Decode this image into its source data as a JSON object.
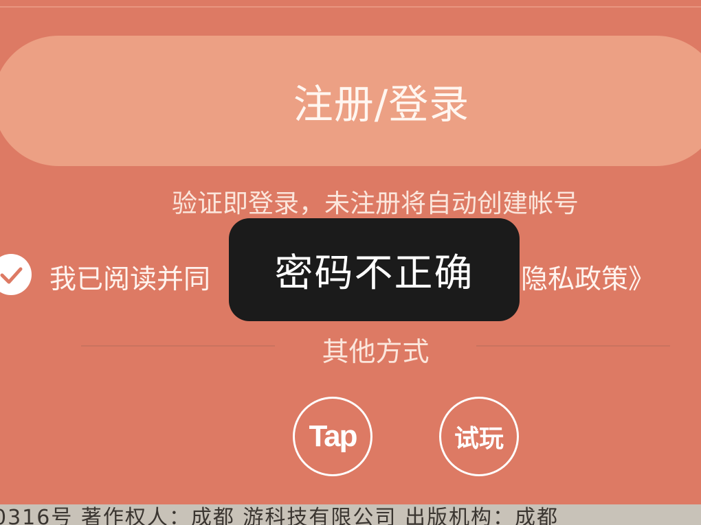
{
  "login": {
    "button_label": "注册/登录",
    "hint": "验证即登录，未注册将自动创建帐号"
  },
  "agreement": {
    "checked": true,
    "text": "我已阅读并同",
    "privacy_link": "隐私政策》"
  },
  "toast": {
    "message": "密码不正确"
  },
  "other": {
    "label": "其他方式",
    "tap_label": "Tap",
    "trial_label": "试玩"
  },
  "footer": {
    "text": "0316号 著作权人：成都 游科技有限公司 出版机构：成都"
  },
  "colors": {
    "background": "#dd7a64",
    "button": "#eca084",
    "toast": "#1b1b1b"
  },
  "icons": {
    "check": "check-circle-icon"
  }
}
